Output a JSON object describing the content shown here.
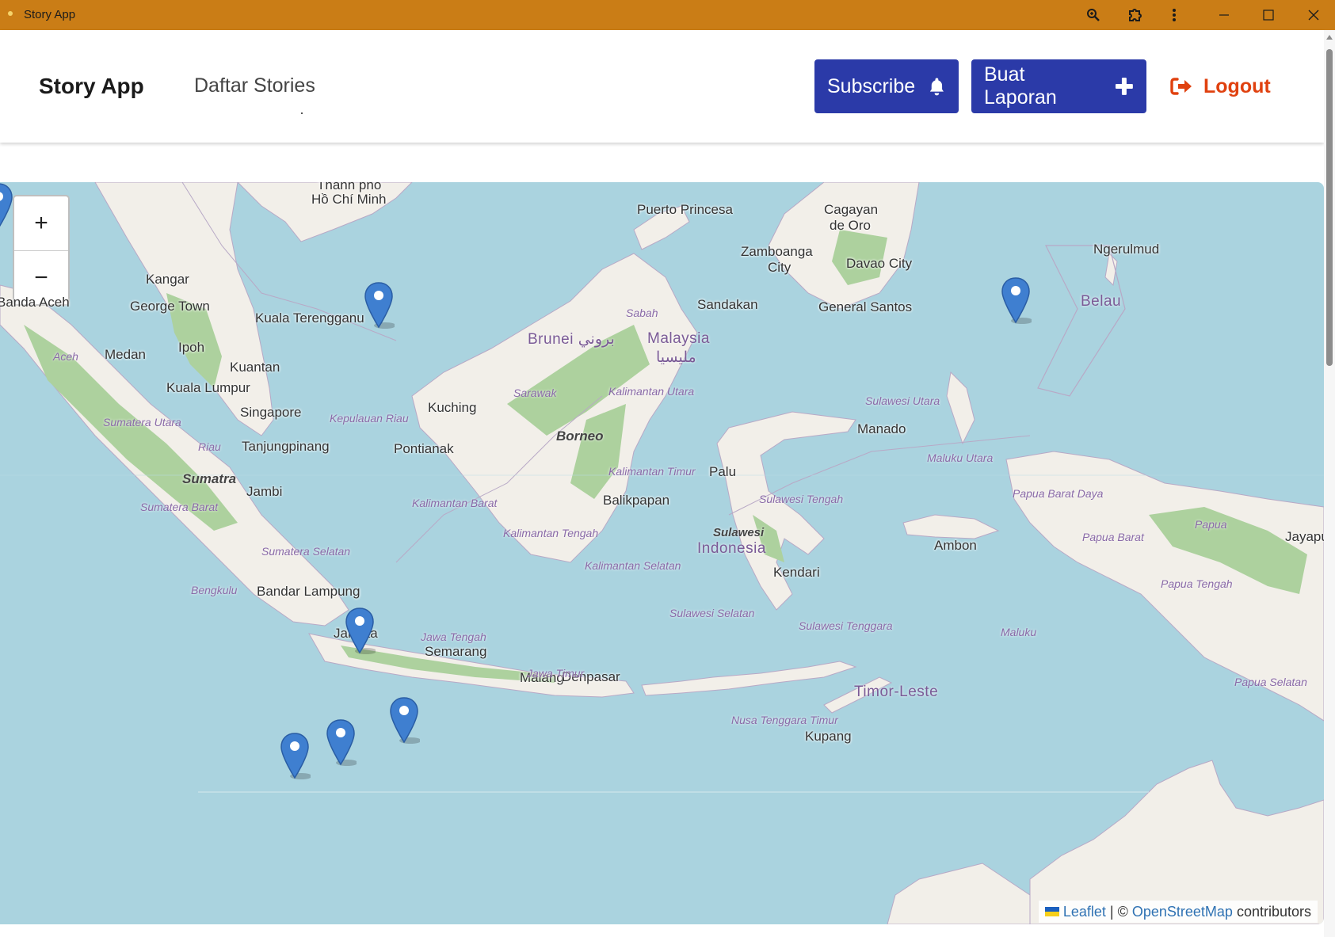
{
  "window": {
    "title": "Story App",
    "icons": [
      "zoom-icon",
      "extension-icon",
      "more-vertical-icon",
      "minimize-icon",
      "maximize-icon",
      "close-icon"
    ]
  },
  "navbar": {
    "brand": "Story App",
    "link_stories": "Daftar Stories",
    "subscribe_label": "Subscribe",
    "report_label": "Buat Laporan",
    "logout_label": "Logout"
  },
  "colors": {
    "titlebar": "#ca7d16",
    "primary_button": "#2b3aa8",
    "logout": "#e0410f",
    "water": "#aad3df",
    "land": "#f2efe9",
    "forest": "#add19e",
    "marker": "#3f7fd0"
  },
  "map": {
    "zoom_in": "+",
    "zoom_out": "−",
    "labels": {
      "ho_chi_minh_top": "Thành phố",
      "ho_chi_minh": "Hồ Chí Minh",
      "puerto_princesa": "Puerto Princesa",
      "cagayan": "Cagayan",
      "de_oro": "de Oro",
      "zamboanga": "Zamboanga",
      "city": "City",
      "davao": "Davao City",
      "ngerulmud": "Ngerulmud",
      "kangar": "Kangar",
      "george_town": "George Town",
      "kuala_terengganu": "Kuala Terengganu",
      "banda_aceh": "Banda Aceh",
      "sandakan": "Sandakan",
      "general_santos": "General Santos",
      "ipoh": "Ipoh",
      "medan": "Medan",
      "kuantan": "Kuantan",
      "kuala_lumpur": "Kuala Lumpur",
      "singapore": "Singapore",
      "kuching": "Kuching",
      "tanjungpinang": "Tanjungpinang",
      "pontianak": "Pontianak",
      "manado": "Manado",
      "jambi": "Jambi",
      "palu": "Palu",
      "balikpapan": "Balikpapan",
      "ambon": "Ambon",
      "kendari": "Kendari",
      "bandar_lampung": "Bandar Lampung",
      "jakarta": "Jakarta",
      "semarang": "Semarang",
      "malang": "Malang",
      "denpasar": "Denpasar",
      "kupang": "Kupang",
      "jayapura": "Jayapura"
    },
    "regions": {
      "aceh": "Aceh",
      "sumatera_utara": "Sumatera Utara",
      "riau": "Riau",
      "kepulauan_riau": "Kepulauan Riau",
      "sumatera_barat": "Sumatera Barat",
      "sumatera_selatan": "Sumatera Selatan",
      "bengkulu": "Bengkulu",
      "sabah": "Sabah",
      "sarawak": "Sarawak",
      "kalimantan_utara": "Kalimantan Utara",
      "kalimantan_timur": "Kalimantan Timur",
      "kalimantan_barat": "Kalimantan Barat",
      "kalimantan_tengah": "Kalimantan Tengah",
      "kalimantan_selatan": "Kalimantan Selatan",
      "sulawesi_utara": "Sulawesi Utara",
      "sulawesi_tengah": "Sulawesi Tengah",
      "sulawesi_selatan": "Sulawesi Selatan",
      "sulawesi_tenggara": "Sulawesi Tenggara",
      "maluku_utara": "Maluku Utara",
      "maluku": "Maluku",
      "papua_barat_daya": "Papua Barat Daya",
      "papua_barat": "Papua Barat",
      "papua": "Papua",
      "papua_tengah": "Papua Tengah",
      "papua_selatan": "Papua Selatan",
      "jawa_tengah": "Jawa Tengah",
      "jawa_timur": "Jawa Timur",
      "nusa_tenggara_timur": "Nusa Tenggara Timur",
      "sumatra": "Sumatra",
      "borneo": "Borneo",
      "sulawesi": "Sulawesi"
    },
    "countries": {
      "brunei": "Brunei بروني",
      "malaysia": "Malaysia",
      "malaysia_jawi": "مليسيا",
      "indonesia": "Indonesia",
      "belau": "Belau",
      "timor_leste": "Timor-Leste"
    },
    "marker_count": 7,
    "attribution": {
      "leaflet": "Leaflet",
      "separator": "| ©",
      "osm": "OpenStreetMap",
      "suffix": "contributors"
    }
  }
}
